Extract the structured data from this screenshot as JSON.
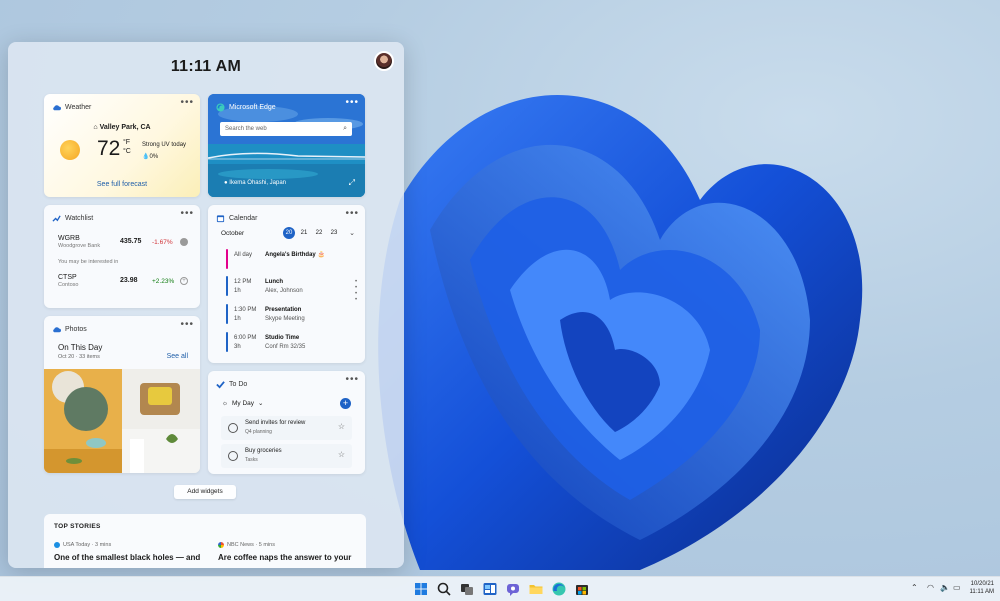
{
  "clock": "11:11 AM",
  "weather": {
    "title": "Weather",
    "location": "Valley Park, CA",
    "temp": "72",
    "unit_f": "°F",
    "unit_c": "°C",
    "condition": "Strong UV today",
    "precip": "0%",
    "link": "See full forecast"
  },
  "edge": {
    "title": "Microsoft Edge",
    "search_placeholder": "Search the web",
    "caption": "Ikema Ohashi, Japan"
  },
  "watchlist": {
    "title": "Watchlist",
    "items": [
      {
        "symbol": "WGRB",
        "name": "Woodgrove Bank",
        "price": "435.75",
        "change": "-1.67%"
      },
      {
        "symbol": "CTSP",
        "name": "Contoso",
        "price": "23.98",
        "change": "+2.23%"
      }
    ],
    "interest_label": "You may be interested in"
  },
  "photos": {
    "title": "Photos",
    "heading": "On This Day",
    "sub": "Oct 20 · 33 items",
    "link": "See all"
  },
  "calendar": {
    "title": "Calendar",
    "month": "October",
    "days": [
      "20",
      "21",
      "22",
      "23"
    ],
    "events": [
      {
        "time": "All day",
        "dur": "",
        "name": "Angela's Birthday 🎂",
        "detail": "",
        "color": "#e3008c"
      },
      {
        "time": "12 PM",
        "dur": "1h",
        "name": "Lunch",
        "detail": "Alex, Johnson",
        "color": "#1f63c6"
      },
      {
        "time": "1:30 PM",
        "dur": "1h",
        "name": "Presentation",
        "detail": "Skype Meeting",
        "color": "#1f63c6"
      },
      {
        "time": "6:00 PM",
        "dur": "3h",
        "name": "Studio Time",
        "detail": "Conf Rm 32/35",
        "color": "#1f63c6"
      }
    ]
  },
  "todo": {
    "title": "To Do",
    "list": "My Day",
    "tasks": [
      {
        "title": "Send invites for review",
        "sub": "Q4 planning"
      },
      {
        "title": "Buy groceries",
        "sub": "Tasks"
      }
    ]
  },
  "add_widgets": "Add widgets",
  "top_stories": {
    "title": "TOP STORIES",
    "items": [
      {
        "source": "USA Today · 3 mins",
        "title": "One of the smallest black holes — and"
      },
      {
        "source": "NBC News · 5 mins",
        "title": "Are coffee naps the answer to your"
      }
    ]
  },
  "taskbar": {
    "date": "10/20/21",
    "time": "11:11 AM"
  },
  "colors": {
    "accent": "#1f63c6",
    "negative": "#d13438",
    "positive": "#107c10"
  }
}
